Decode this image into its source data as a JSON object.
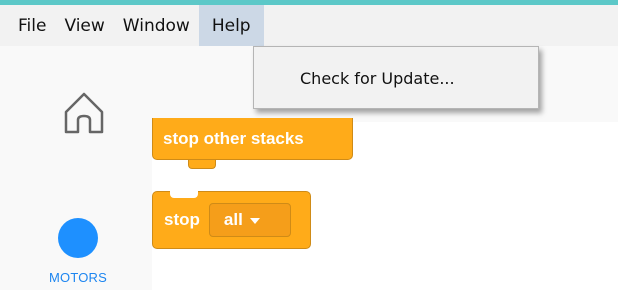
{
  "menubar": {
    "items": [
      "File",
      "View",
      "Window",
      "Help"
    ],
    "open_item": "Help"
  },
  "help_menu": {
    "items": [
      "Check for Update..."
    ]
  },
  "sidebar": {
    "category": {
      "label": "MOTORS",
      "color": "#1e90ff",
      "icon": "circle"
    },
    "home_icon": "home-icon"
  },
  "blocks": {
    "stop_other_stacks": "stop other stacks",
    "stop_label": "stop",
    "stop_option": "all",
    "color": "#ffab19"
  },
  "colors": {
    "accent": "#5cc8c8",
    "menu_open_bg": "#ccd8e6"
  }
}
